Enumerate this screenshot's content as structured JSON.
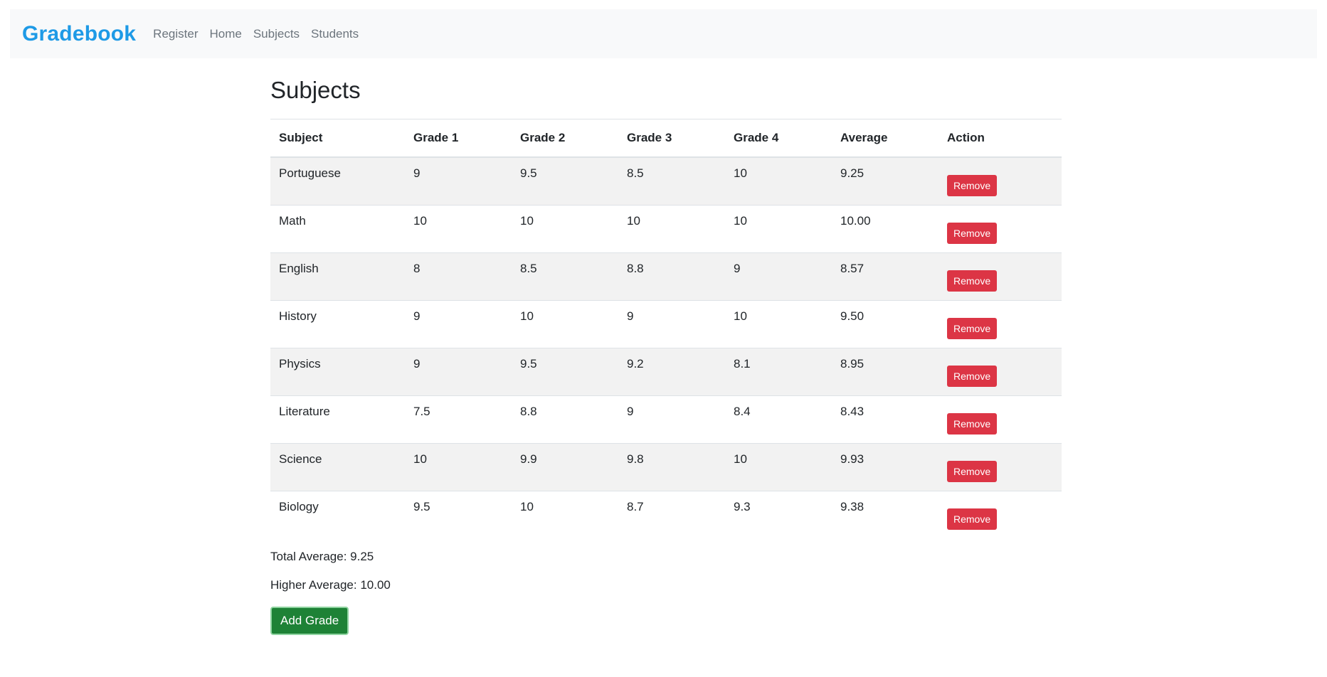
{
  "navbar": {
    "brand": "Gradebook",
    "links": [
      "Register",
      "Home",
      "Subjects",
      "Students"
    ]
  },
  "page": {
    "title": "Subjects"
  },
  "table": {
    "headers": [
      "Subject",
      "Grade 1",
      "Grade 2",
      "Grade 3",
      "Grade 4",
      "Average",
      "Action"
    ],
    "rows": [
      [
        "Portuguese",
        "9",
        "9.5",
        "8.5",
        "10",
        "9.25"
      ],
      [
        "Math",
        "10",
        "10",
        "10",
        "10",
        "10.00"
      ],
      [
        "English",
        "8",
        "8.5",
        "8.8",
        "9",
        "8.57"
      ],
      [
        "History",
        "9",
        "10",
        "9",
        "10",
        "9.50"
      ],
      [
        "Physics",
        "9",
        "9.5",
        "9.2",
        "8.1",
        "8.95"
      ],
      [
        "Literature",
        "7.5",
        "8.8",
        "9",
        "8.4",
        "8.43"
      ],
      [
        "Science",
        "10",
        "9.9",
        "9.8",
        "10",
        "9.93"
      ],
      [
        "Biology",
        "9.5",
        "10",
        "8.7",
        "9.3",
        "9.38"
      ]
    ],
    "remove_label": "Remove"
  },
  "summary": {
    "total_average": "Total Average: 9.25",
    "higher_average": "Higher Average: 10.00"
  },
  "actions": {
    "add_grade_label": "Add Grade"
  },
  "colors": {
    "brand": "#1e9ae6",
    "danger": "#dc3545",
    "success": "#1e8236",
    "navbar_bg": "#f8f9fa"
  }
}
